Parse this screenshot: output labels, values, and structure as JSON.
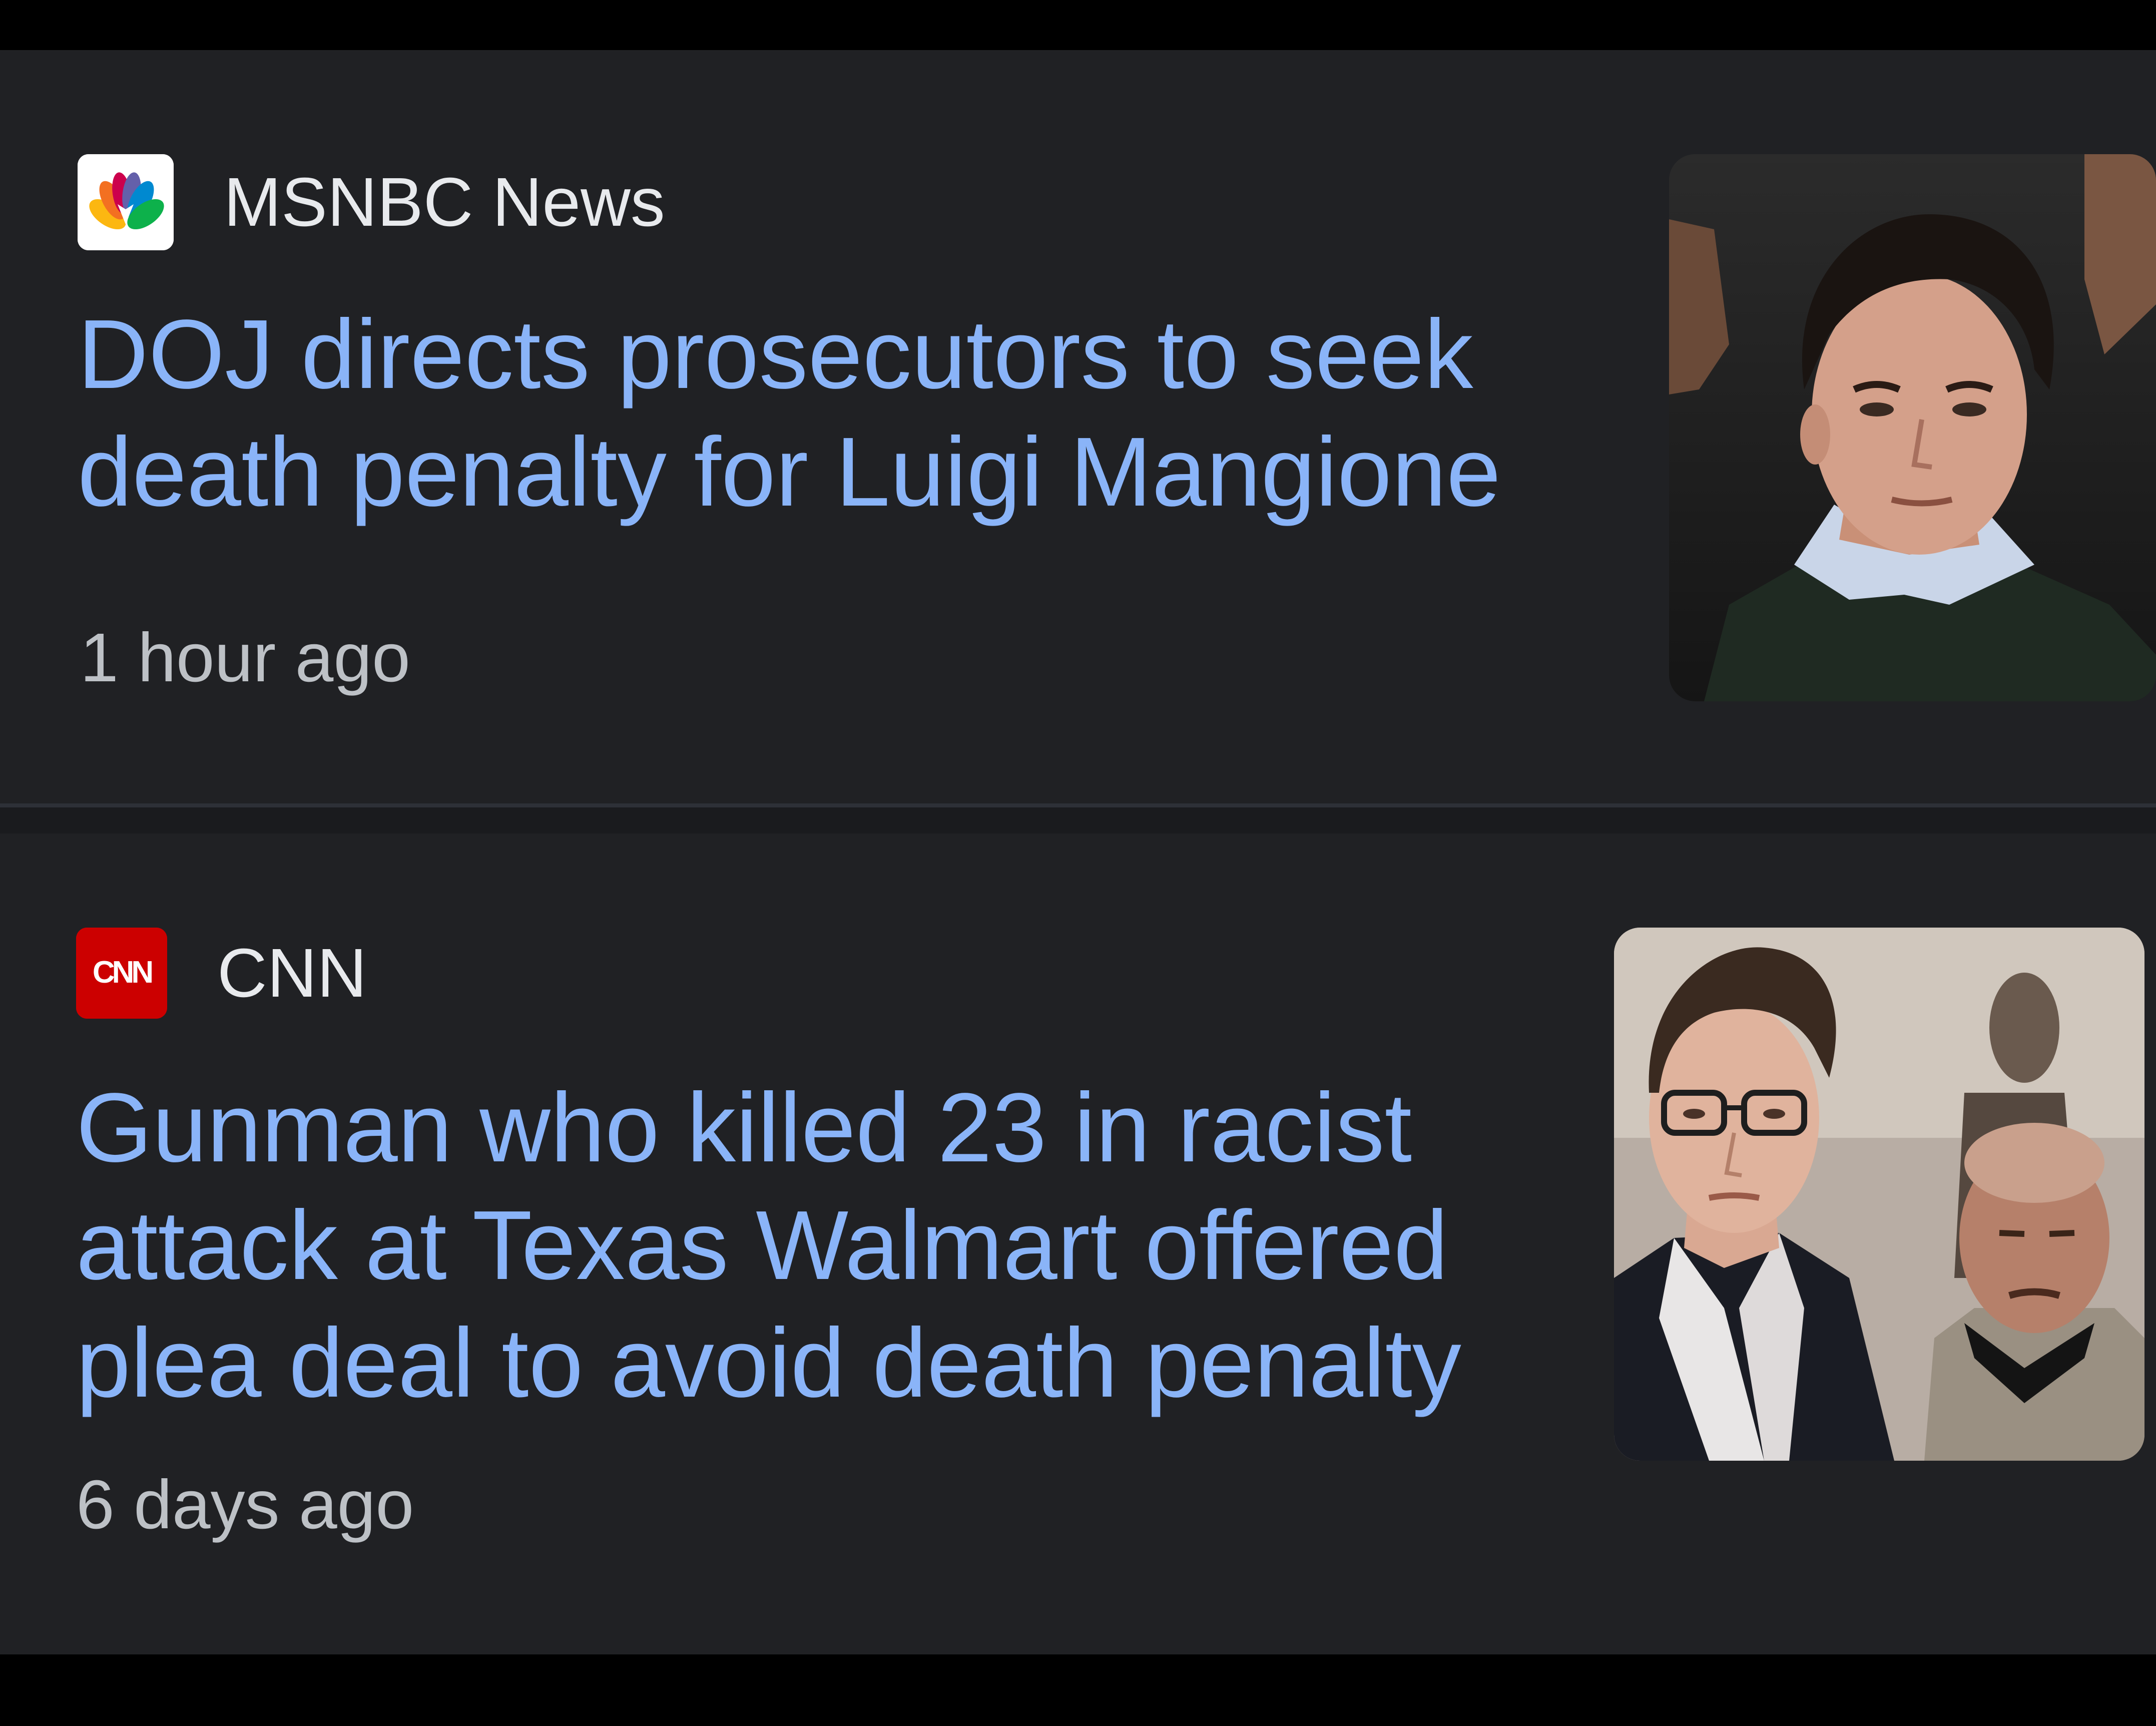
{
  "feed": {
    "articles": [
      {
        "source": "MSNBC News",
        "logo_icon": "msnbc-peacock-icon",
        "headline": "DOJ directs prosecutors to seek death penalty for Luigi Mangione",
        "time": "1 hour ago"
      },
      {
        "source": "CNN",
        "logo_icon": "cnn-logo-icon",
        "logo_text": "CNN",
        "headline": "Gunman who killed 23 in racist attack at Texas Walmart offered plea deal to avoid death penalty",
        "time": "6 days ago"
      }
    ]
  },
  "colors": {
    "background": "#202124",
    "headline": "#8ab4f8",
    "source_text": "#e8eaed",
    "time_text": "#bdc1c6",
    "cnn_red": "#cc0000"
  }
}
